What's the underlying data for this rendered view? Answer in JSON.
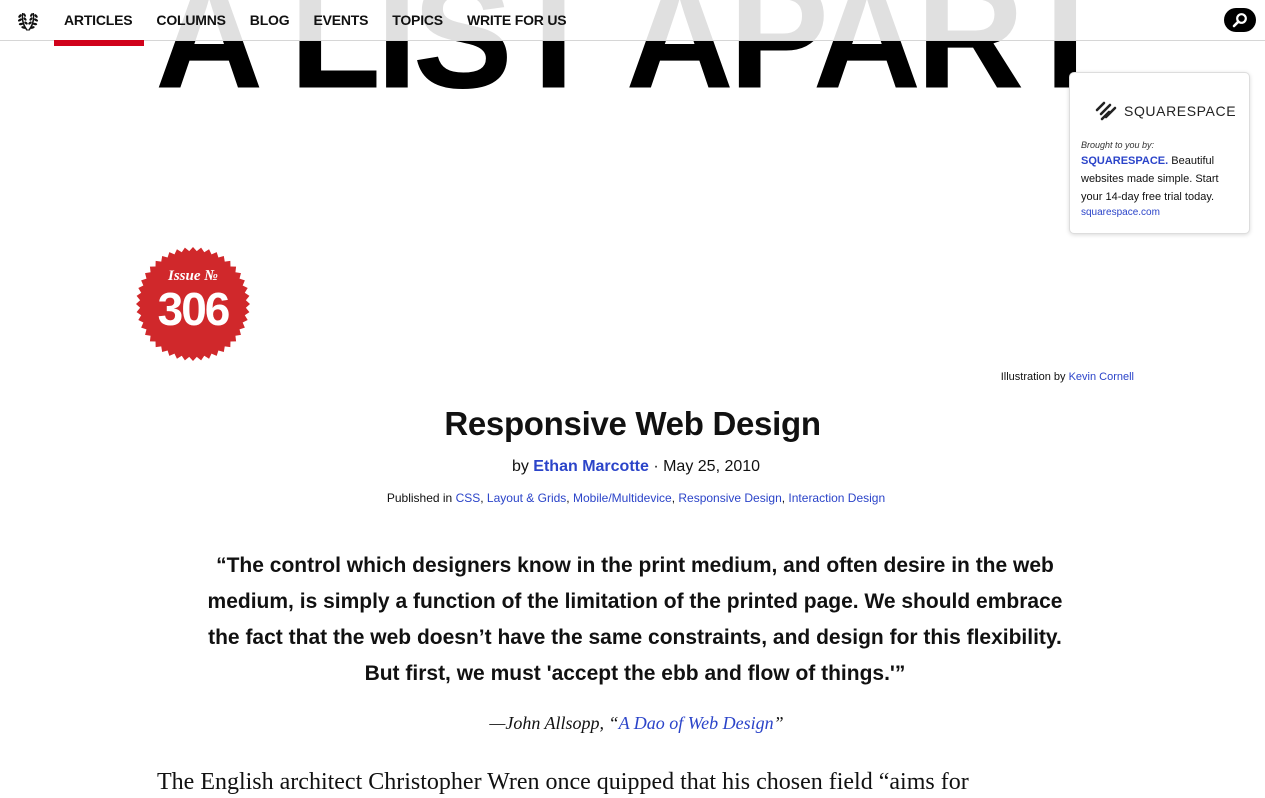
{
  "masthead": {
    "title": "A LIST APART"
  },
  "nav": {
    "items": [
      {
        "label": "ARTICLES",
        "active": true
      },
      {
        "label": "COLUMNS"
      },
      {
        "label": "BLOG"
      },
      {
        "label": "EVENTS"
      },
      {
        "label": "TOPICS"
      },
      {
        "label": "WRITE FOR US"
      }
    ],
    "logo_icon": "laurel-wreath-icon",
    "search_icon": "search-icon"
  },
  "sponsor": {
    "logo_text": "SQUARESPACE",
    "brought_by": "Brought to you by:",
    "brand": "SQUARESPACE.",
    "text": " Beautiful websites made simple. Start your 14-day free trial today.",
    "link": "squarespace.com"
  },
  "badge": {
    "label": "Issue №",
    "number": "306",
    "color": "#d0282b"
  },
  "illustration": {
    "prefix": "Illustration by ",
    "artist": "Kevin Cornell"
  },
  "article": {
    "title": "Responsive Web Design",
    "by": "by ",
    "author": "Ethan Marcotte",
    "date_sep": " · ",
    "date": "May 25, 2010",
    "published_prefix": "Published in ",
    "categories": [
      "CSS",
      "Layout & Grids",
      "Mobile/Multidevice",
      "Responsive Design",
      "Interaction Design"
    ],
    "pullquote": "“The control which designers know in the print medium, and often desire in the web medium, is simply a function of the limitation of the printed page. We should embrace the fact that the web doesn’t have the same constraints, and design for this flexibility. But first, we must 'accept the ebb and flow of things.'”",
    "attribution_prefix": "—John Allsopp, “",
    "attribution_link": "A Dao of Web Design",
    "attribution_suffix": "”",
    "body_start": "The English architect Christopher Wren once quipped that his chosen field “aims for"
  },
  "colors": {
    "accent_red": "#d0021b",
    "link_blue": "#2b44c9"
  }
}
